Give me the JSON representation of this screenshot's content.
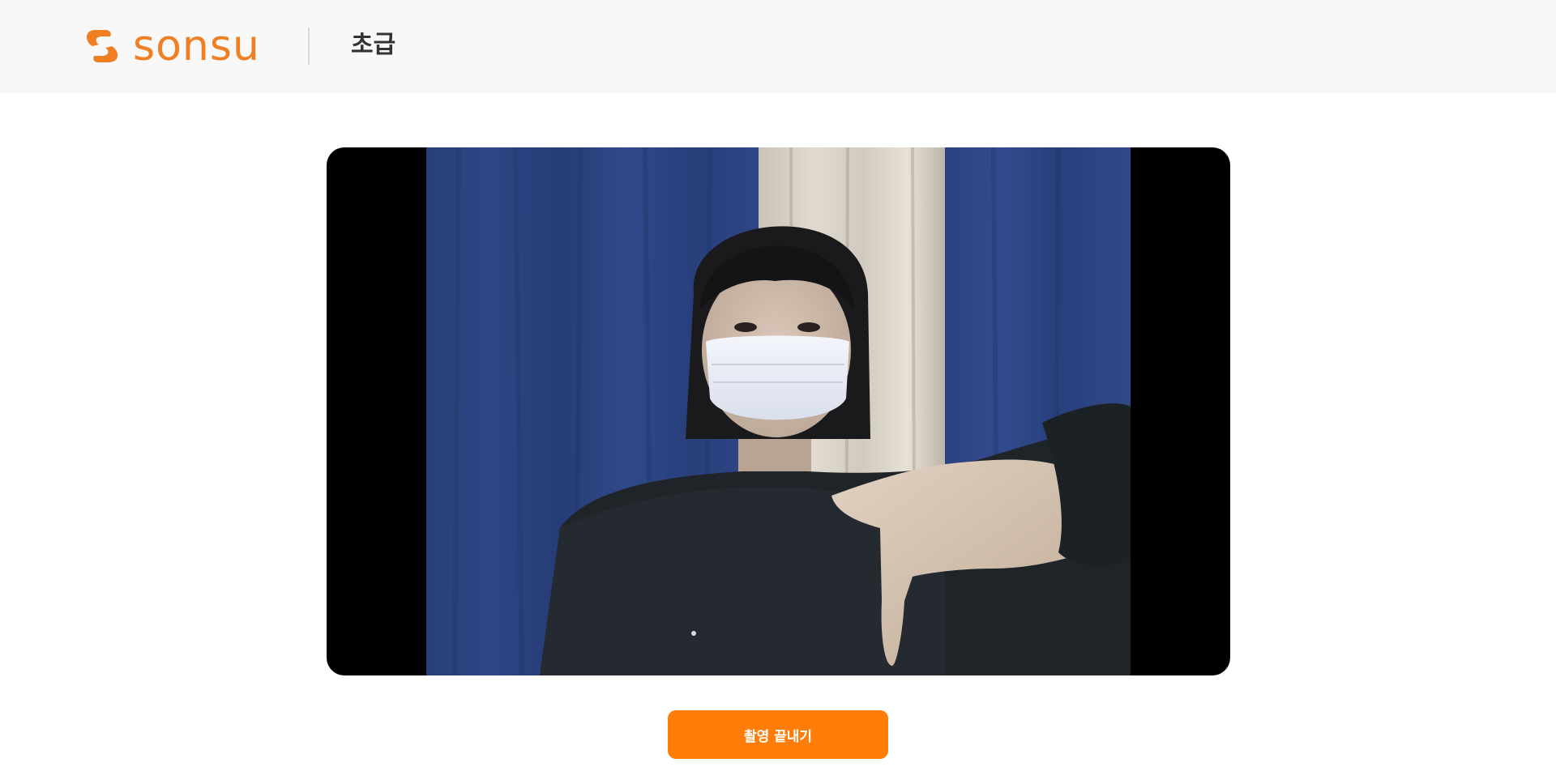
{
  "header": {
    "logo_text": "sonsu",
    "level_title": "초급"
  },
  "camera": {
    "content": "webcam-feed"
  },
  "actions": {
    "end_recording_label": "촬영 끝내기"
  },
  "colors": {
    "brand_orange": "#f07e22",
    "button_orange": "#ff7d08",
    "header_bg": "#f8f8f8",
    "frame_bg": "#000000"
  }
}
